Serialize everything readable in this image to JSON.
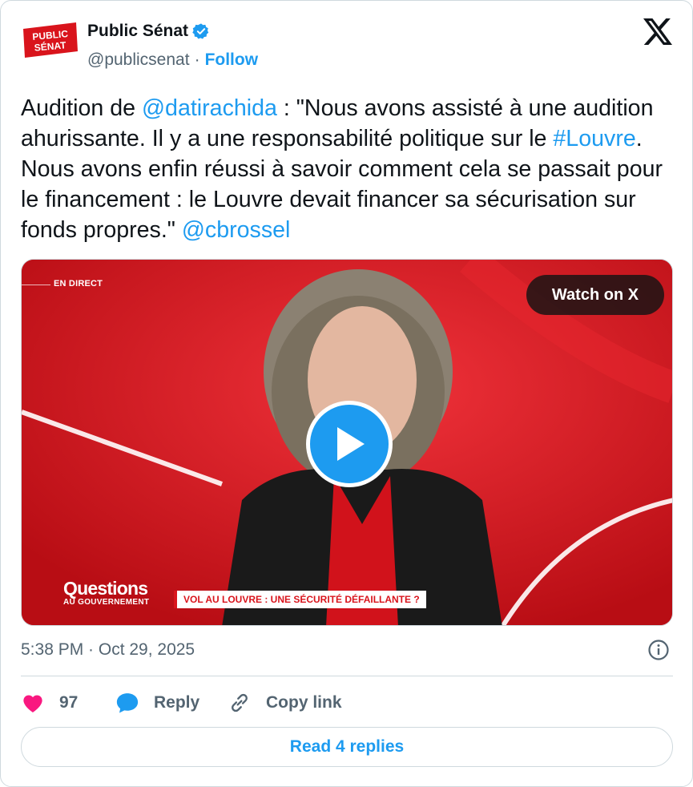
{
  "author": {
    "name": "Public Sénat",
    "handle": "@publicsenat",
    "separator": "·",
    "follow_label": "Follow",
    "avatar_logo_text": [
      "PUBLIC",
      "SÉNAT"
    ]
  },
  "tweet": {
    "text_before_1": "Audition de ",
    "mention_1": "@datirachida",
    "text_mid_1": " : \"Nous avons assisté à une audition ahurissante. Il y a une responsabilité politique sur le ",
    "hashtag": "#Louvre",
    "text_mid_2": ". Nous avons enfin réussi à savoir comment cela se passait pour le financement : le Louvre devait financer sa sécurisation sur fonds propres.\" ",
    "mention_2": "@cbrossel"
  },
  "media": {
    "live_label": "EN DIRECT",
    "watch_label": "Watch on X",
    "show_title": "Questions",
    "show_subtitle": "AU GOUVERNEMENT",
    "lower_third": "VOL AU LOUVRE : UNE SÉCURITÉ DÉFAILLANTE ?"
  },
  "meta": {
    "timestamp": "5:38 PM · Oct 29, 2025"
  },
  "actions": {
    "like_count": "97",
    "reply_label": "Reply",
    "copy_label": "Copy link"
  },
  "read_replies_label": "Read 4 replies",
  "colors": {
    "accent": "#1d9bf0",
    "like": "#f91880",
    "text": "#0f1419",
    "muted": "#536471",
    "border": "#cfd9de",
    "brand_red": "#d9141c"
  },
  "icons": [
    "verified-badge-icon",
    "x-logo-icon",
    "play-icon",
    "info-icon",
    "heart-icon",
    "reply-bubble-icon",
    "link-icon"
  ]
}
